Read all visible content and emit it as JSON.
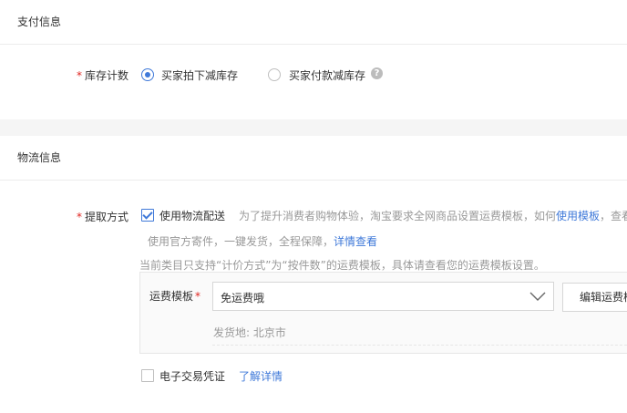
{
  "payment": {
    "section_title": "支付信息",
    "inventory_label": "库存计数",
    "options": [
      {
        "label": "买家拍下减库存",
        "selected": true
      },
      {
        "label": "买家付款减库存",
        "selected": false
      }
    ],
    "help_glyph": "?"
  },
  "logistics": {
    "section_title": "物流信息",
    "pickup_label": "提取方式",
    "use_logistics_label": "使用物流配送",
    "use_logistics_checked": true,
    "hint_prefix": "为了提升消费者购物体验，淘宝要求全网商品设置运费模板，如何",
    "hint_link": "使用模板",
    "hint_suffix": "，查看",
    "official_text": "使用官方寄件，一键发货，全程保障，",
    "official_link": "详情查看",
    "category_note": "当前类目只支持“计价方式”为“按件数”的运费模板，具体请查看您的运费模板设置。",
    "template_label": "运费模板",
    "template_value": "免运费哦",
    "edit_button": "编辑运费模板",
    "ship_from": "发货地: 北京市",
    "evoucher_label": "电子交易凭证",
    "evoucher_checked": false,
    "learn_more": "了解详情"
  },
  "colors": {
    "accent": "#3f79d9",
    "required": "#e0241f"
  },
  "icons": [
    "help-icon",
    "chevron-down-icon",
    "check-icon"
  ]
}
